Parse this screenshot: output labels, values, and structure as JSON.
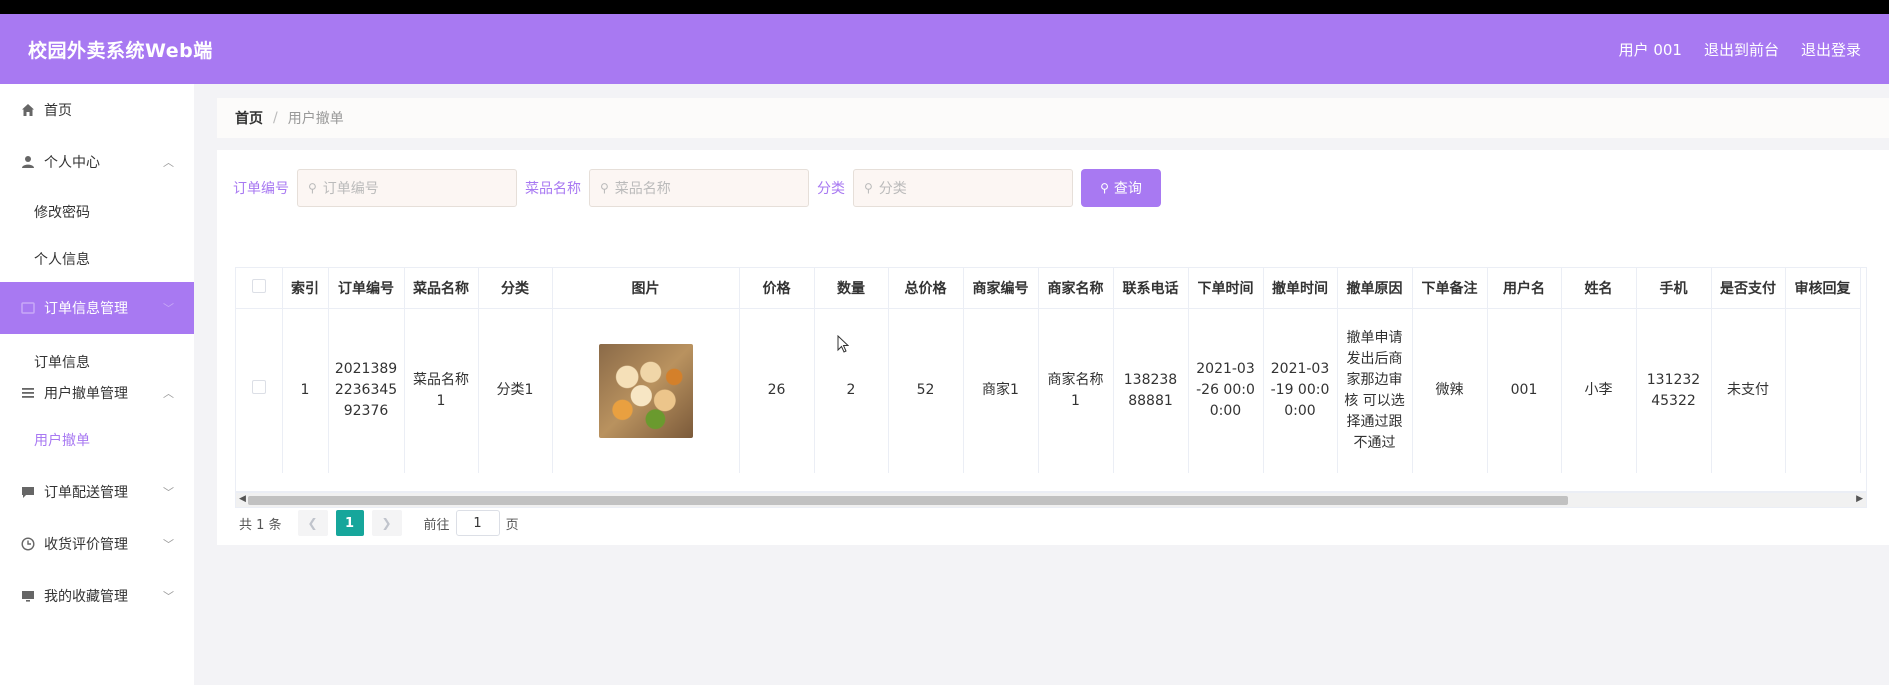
{
  "app": {
    "title": "校园外卖系统Web端"
  },
  "header": {
    "user": "用户 001",
    "back_to_front": "退出到前台",
    "logout": "退出登录"
  },
  "sidebar": {
    "items": [
      {
        "label": "首页",
        "icon": "home-icon"
      },
      {
        "label": "个人中心",
        "icon": "user-icon",
        "expanded": true,
        "children": [
          "修改密码",
          "个人信息"
        ]
      },
      {
        "label": "订单信息管理",
        "icon": "order-icon",
        "active": true,
        "children": [
          "订单信息"
        ]
      },
      {
        "label": "用户撤单管理",
        "icon": "list-icon",
        "expanded": true,
        "children": [
          "用户撤单"
        ]
      },
      {
        "label": "订单配送管理",
        "icon": "chat-icon"
      },
      {
        "label": "收货评价管理",
        "icon": "clock-icon"
      },
      {
        "label": "我的收藏管理",
        "icon": "monitor-icon"
      }
    ]
  },
  "breadcrumb": {
    "home": "首页",
    "separator": "/",
    "current": "用户撤单"
  },
  "search": {
    "order_no_label": "订单编号",
    "order_no_placeholder": "订单编号",
    "dish_label": "菜品名称",
    "dish_placeholder": "菜品名称",
    "category_label": "分类",
    "category_placeholder": "分类",
    "button": "查询"
  },
  "table": {
    "columns": [
      "索引",
      "订单编号",
      "菜品名称",
      "分类",
      "图片",
      "价格",
      "数量",
      "总价格",
      "商家编号",
      "商家名称",
      "联系电话",
      "下单时间",
      "撤单时间",
      "撤单原因",
      "下单备注",
      "用户名",
      "姓名",
      "手机",
      "是否支付",
      "审核回复"
    ],
    "rows": [
      {
        "index": "1",
        "order_no": "20213892236345 92376",
        "dish": "菜品名称1",
        "category": "分类1",
        "price": "26",
        "qty": "2",
        "total": "52",
        "merchant_no": "商家1",
        "merchant_name": "商家名称1",
        "phone": "13823888881",
        "order_time": "2021-03-26 00:00:00",
        "cancel_time": "2021-03-19 00:00:00",
        "cancel_reason": "撤单申请发出后商家那边审核 可以选择通过跟不通过",
        "remark": "微辣",
        "username": "001",
        "name": "小李",
        "mobile": "13123245322",
        "paid": "未支付",
        "review": ""
      }
    ]
  },
  "pagination": {
    "total": "共 1 条",
    "current_page": "1",
    "goto_label": "前往",
    "goto_value": "1",
    "page_suffix": "页"
  },
  "colors": {
    "accent": "#a879f2",
    "page_active": "#16a69b"
  }
}
